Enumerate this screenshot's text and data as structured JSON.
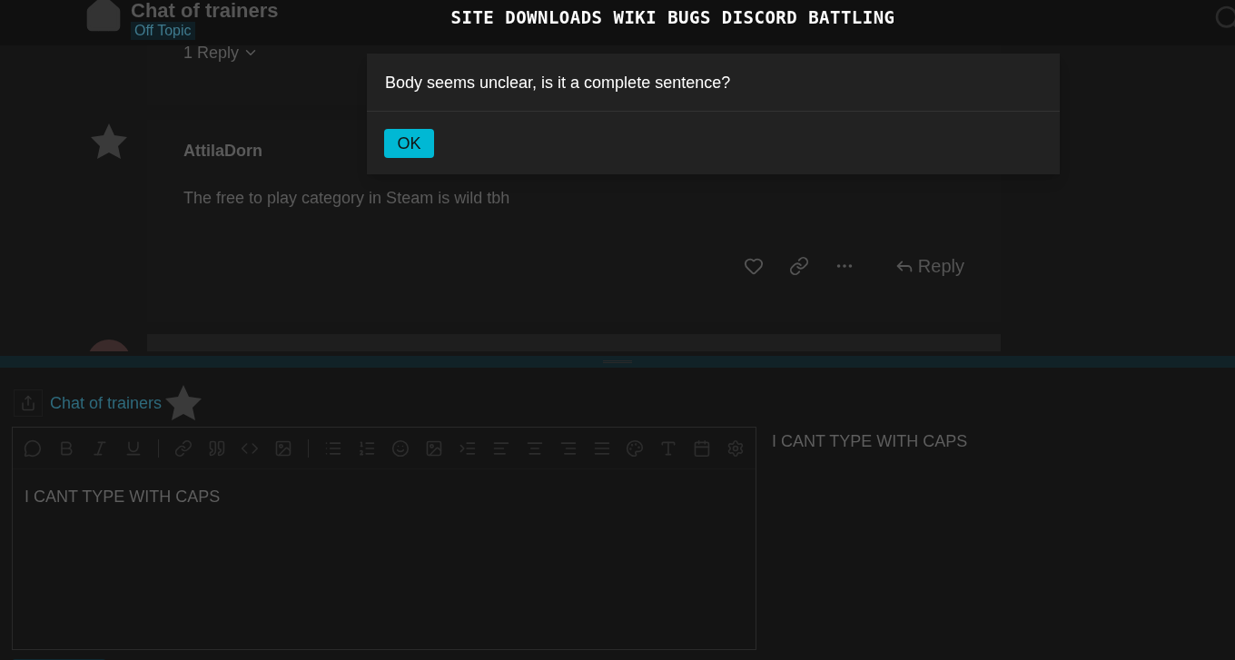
{
  "header": {
    "title": "Chat of trainers",
    "tag": "Off Topic",
    "nav": [
      "SITE",
      "DOWNLOADS",
      "WIKI",
      "BUGS",
      "DISCORD",
      "BATTLING"
    ]
  },
  "posts": [
    {
      "kind": "tail",
      "replies": "1 Reply"
    },
    {
      "kind": "full",
      "author": "AttilaDorn",
      "body": "The free to play category in Steam is wild tbh",
      "reply": "Reply"
    },
    {
      "kind": "stub"
    }
  ],
  "composer": {
    "topic": "Chat of trainers",
    "text": "I CANT TYPE WITH CAPS",
    "preview": "I CANT TYPE WITH CAPS"
  },
  "dialog": {
    "message": "Body seems unclear, is it a complete sentence?",
    "button": "OK"
  }
}
